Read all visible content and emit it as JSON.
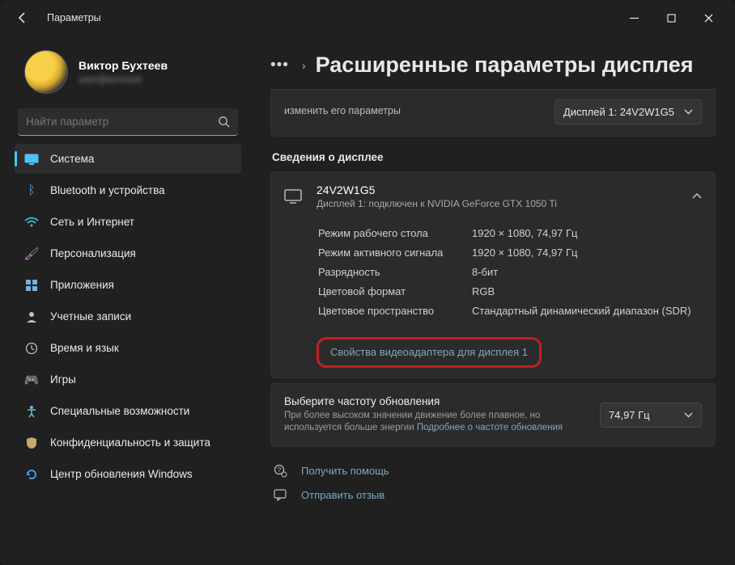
{
  "titlebar": {
    "title": "Параметры"
  },
  "profile": {
    "name": "Виктор Бухтеев",
    "sub": "user@account"
  },
  "search": {
    "placeholder": "Найти параметр"
  },
  "nav": {
    "items": [
      {
        "label": "Система"
      },
      {
        "label": "Bluetooth и устройства"
      },
      {
        "label": "Сеть и Интернет"
      },
      {
        "label": "Персонализация"
      },
      {
        "label": "Приложения"
      },
      {
        "label": "Учетные записи"
      },
      {
        "label": "Время и язык"
      },
      {
        "label": "Игры"
      },
      {
        "label": "Специальные возможности"
      },
      {
        "label": "Конфиденциальность и защита"
      },
      {
        "label": "Центр обновления Windows"
      }
    ]
  },
  "page": {
    "heading": "Расширенные параметры дисплея",
    "topcard_text": "изменить его параметры",
    "ddl_value": "Дисплей 1: 24V2W1G5",
    "section_info": "Сведения о дисплее",
    "display": {
      "name": "24V2W1G5",
      "sub": "Дисплей 1: подключен к NVIDIA GeForce GTX 1050 Ti",
      "table": {
        "k0": "Режим рабочего стола",
        "v0": "1920 × 1080, 74,97 Гц",
        "k1": "Режим активного сигнала",
        "v1": "1920 × 1080, 74,97 Гц",
        "k2": "Разрядность",
        "v2": "8-бит",
        "k3": "Цветовой формат",
        "v3": "RGB",
        "k4": "Цветовое пространство",
        "v4": "Стандартный динамический диапазон (SDR)"
      },
      "adapter_link": "Свойства видеоадаптера для дисплея 1"
    },
    "refresh": {
      "title": "Выберите частоту обновления",
      "sub": "При более высоком значении движение более плавное, но используется больше энергии ",
      "more": "Подробнее о частоте обновления",
      "value": "74,97 Гц"
    },
    "footer": {
      "help": "Получить помощь",
      "feedback": "Отправить отзыв"
    }
  }
}
